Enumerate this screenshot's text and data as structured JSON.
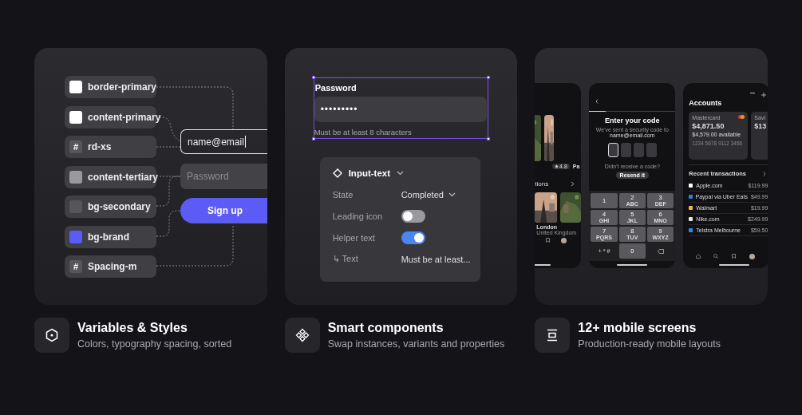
{
  "cards": [
    {
      "kind": "tokens",
      "tokens": [
        {
          "kind": "color",
          "name": "border-primary",
          "color": "#ffffff"
        },
        {
          "kind": "color",
          "name": "content-primary",
          "color": "#ffffff"
        },
        {
          "kind": "number",
          "name": "rd-xs",
          "glyph": "#"
        },
        {
          "kind": "color",
          "name": "content-tertiary",
          "color": "#9a9a9e"
        },
        {
          "kind": "color",
          "name": "bg-secondary",
          "color": "#55555a"
        },
        {
          "kind": "color",
          "name": "bg-brand",
          "color": "#5b5bf5"
        },
        {
          "kind": "number",
          "name": "Spacing-m",
          "glyph": "#"
        }
      ],
      "form": {
        "email_value": "name@email",
        "password_placeholder": "Password",
        "button": "Sign up"
      }
    },
    {
      "kind": "component",
      "field": {
        "label": "Password",
        "value": "•••••••••",
        "helper": "Must be at least 8 characters",
        "selected": true
      },
      "panel": {
        "title": "Input-text",
        "rows": [
          {
            "kind": "select",
            "label": "State",
            "value": "Completed"
          },
          {
            "kind": "toggle",
            "label": "Leading icon",
            "on": false
          },
          {
            "kind": "toggle",
            "label": "Helper text",
            "on": true
          },
          {
            "kind": "text",
            "label": "↳ Text",
            "value": "Must be at least..."
          }
        ]
      }
    },
    {
      "kind": "screens",
      "travel": {
        "rating": "4.8",
        "title_fragment": "Pa",
        "section": "tions",
        "place": "London",
        "place_sub": "United Kingdom"
      },
      "code": {
        "title": "Enter your code",
        "message": "We've sent a security code to",
        "email": "name@email.com",
        "slots": [
          {
            "selected": true
          },
          {
            "selected": false
          },
          {
            "selected": false
          },
          {
            "selected": false
          }
        ],
        "prompt": "Didn't receive a code?",
        "resend": "Resend it",
        "keys": [
          {
            "kind": "digit",
            "digit": "1"
          },
          {
            "kind": "digit",
            "digit": "2",
            "letters": "ABC"
          },
          {
            "kind": "digit",
            "digit": "3",
            "letters": "DEF"
          },
          {
            "kind": "digit",
            "digit": "4",
            "letters": "GHI"
          },
          {
            "kind": "digit",
            "digit": "5",
            "letters": "JKL"
          },
          {
            "kind": "digit",
            "digit": "6",
            "letters": "MNO"
          },
          {
            "kind": "digit",
            "digit": "7",
            "letters": "PQRS"
          },
          {
            "kind": "digit",
            "digit": "8",
            "letters": "TUV"
          },
          {
            "kind": "digit",
            "digit": "9",
            "letters": "WXYZ"
          },
          {
            "kind": "symbol",
            "digit": "+ * #"
          },
          {
            "kind": "digit",
            "digit": "0"
          },
          {
            "kind": "delete"
          }
        ]
      },
      "accounts": {
        "title": "Accounts",
        "cards": [
          {
            "name": "Mastercard",
            "balance": "$4,871.50",
            "available": "$4,579.00 available",
            "number": "1234 5678 9112 3456"
          },
          {
            "name": "Savi",
            "balance": "$13"
          }
        ],
        "section": "Recent transactions",
        "transactions": [
          {
            "name": "Apple.com",
            "amount": "$119.99",
            "color": "#ffffff"
          },
          {
            "name": "Paypal via Uber Eats",
            "amount": "$49.99",
            "color": "#2f7de1"
          },
          {
            "name": "Walmart",
            "amount": "$19.99",
            "color": "#f5b724"
          },
          {
            "name": "Nike.com",
            "amount": "$249.99",
            "color": "#e8e8e8"
          },
          {
            "name": "Telstra Melbourne",
            "amount": "$59.50",
            "color": "#1f8ff0"
          }
        ]
      }
    }
  ],
  "features": [
    {
      "kind": "hexagon",
      "title": "Variables & Styles",
      "subtitle": "Colors, typography spacing, sorted"
    },
    {
      "kind": "diamonds",
      "title": "Smart components",
      "subtitle": "Swap instances, variants and properties"
    },
    {
      "kind": "stack",
      "title": "12+ mobile screens",
      "subtitle": "Production-ready mobile layouts"
    }
  ]
}
